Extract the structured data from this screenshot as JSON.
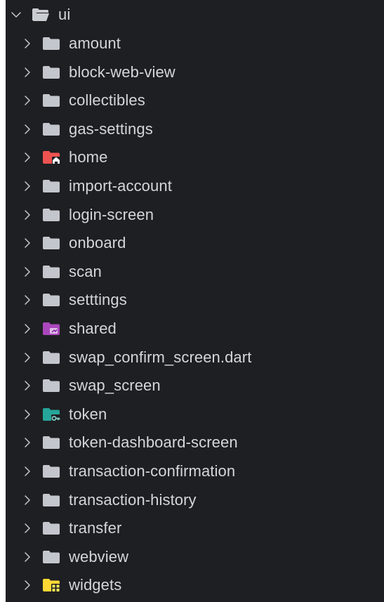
{
  "explorer": {
    "root": {
      "label": "ui",
      "expanded": true,
      "icon": "folder-open-icon",
      "color": "#c9ccd1"
    },
    "items": [
      {
        "label": "amount",
        "icon": "folder-icon",
        "color": "#c3c6cc"
      },
      {
        "label": "block-web-view",
        "icon": "folder-icon",
        "color": "#c3c6cc"
      },
      {
        "label": "collectibles",
        "icon": "folder-icon",
        "color": "#c3c6cc"
      },
      {
        "label": "gas-settings",
        "icon": "folder-icon",
        "color": "#c3c6cc"
      },
      {
        "label": "home",
        "icon": "folder-home-icon",
        "color": "#ef5350"
      },
      {
        "label": "import-account",
        "icon": "folder-icon",
        "color": "#c3c6cc"
      },
      {
        "label": "login-screen",
        "icon": "folder-icon",
        "color": "#c3c6cc"
      },
      {
        "label": "onboard",
        "icon": "folder-icon",
        "color": "#c3c6cc"
      },
      {
        "label": "scan",
        "icon": "folder-icon",
        "color": "#c3c6cc"
      },
      {
        "label": "setttings",
        "icon": "folder-icon",
        "color": "#c3c6cc"
      },
      {
        "label": "shared",
        "icon": "folder-shared-icon",
        "color": "#ab47bc"
      },
      {
        "label": "swap_confirm_screen.dart",
        "icon": "folder-icon",
        "color": "#c3c6cc"
      },
      {
        "label": "swap_screen",
        "icon": "folder-icon",
        "color": "#c3c6cc"
      },
      {
        "label": "token",
        "icon": "folder-token-icon",
        "color": "#26a69a"
      },
      {
        "label": "token-dashboard-screen",
        "icon": "folder-icon",
        "color": "#c3c6cc"
      },
      {
        "label": "transaction-confirmation",
        "icon": "folder-icon",
        "color": "#c3c6cc"
      },
      {
        "label": "transaction-history",
        "icon": "folder-icon",
        "color": "#c3c6cc"
      },
      {
        "label": "transfer",
        "icon": "folder-icon",
        "color": "#c3c6cc"
      },
      {
        "label": "webview",
        "icon": "folder-icon",
        "color": "#c3c6cc"
      },
      {
        "label": "widgets",
        "icon": "folder-widgets-icon",
        "color": "#fdd835"
      }
    ]
  },
  "colors": {
    "background": "#1e1f22",
    "text": "#d4d6da",
    "chevron": "#c5c7cc"
  }
}
